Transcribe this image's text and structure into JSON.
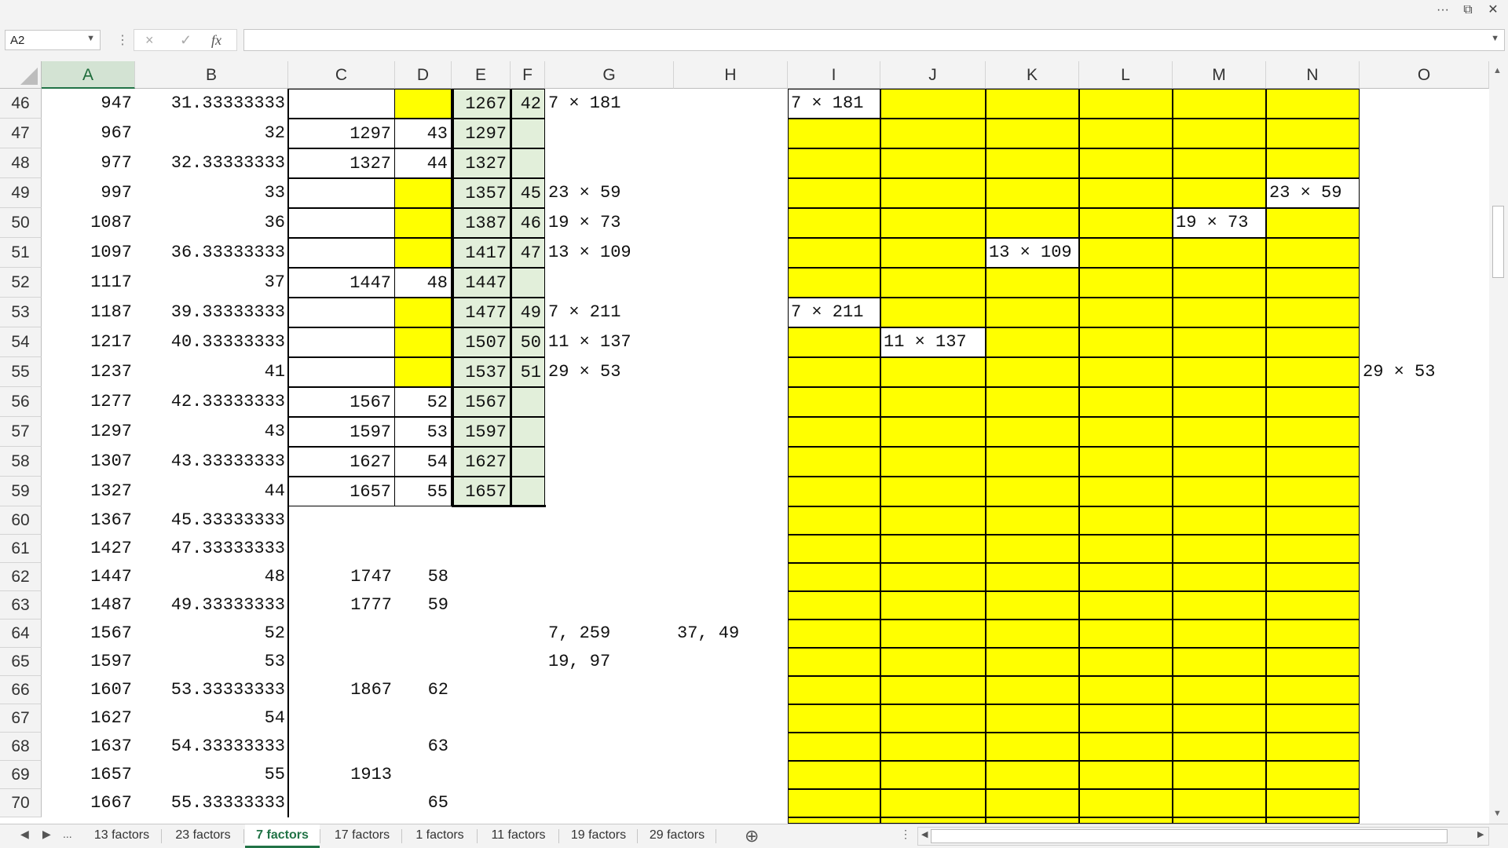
{
  "window": {
    "more_icon": "ellipsis-icon",
    "restore_icon": "restore-icon",
    "close_icon": "close-icon"
  },
  "formula_bar": {
    "name_box": "A2",
    "cancel_icon": "×",
    "enter_icon": "✓",
    "fx_label": "fx",
    "formula": ""
  },
  "columns": [
    "A",
    "B",
    "C",
    "D",
    "E",
    "F",
    "G",
    "H",
    "I",
    "J",
    "K",
    "L",
    "M",
    "N",
    "O"
  ],
  "selected_column": "A",
  "rows": [
    {
      "n": "46",
      "A": "947",
      "B": "31.33333333",
      "C": "",
      "D": "",
      "E": "1267",
      "F": "42",
      "G": "7 × 181",
      "H": ""
    },
    {
      "n": "47",
      "A": "967",
      "B": "32",
      "C": "1297",
      "D": "43",
      "E": "1297",
      "F": "",
      "G": "",
      "H": ""
    },
    {
      "n": "48",
      "A": "977",
      "B": "32.33333333",
      "C": "1327",
      "D": "44",
      "E": "1327",
      "F": "",
      "G": "",
      "H": ""
    },
    {
      "n": "49",
      "A": "997",
      "B": "33",
      "C": "",
      "D": "",
      "E": "1357",
      "F": "45",
      "G": "23 × 59",
      "H": ""
    },
    {
      "n": "50",
      "A": "1087",
      "B": "36",
      "C": "",
      "D": "",
      "E": "1387",
      "F": "46",
      "G": "19 × 73",
      "H": ""
    },
    {
      "n": "51",
      "A": "1097",
      "B": "36.33333333",
      "C": "",
      "D": "",
      "E": "1417",
      "F": "47",
      "G": "13 × 109",
      "H": ""
    },
    {
      "n": "52",
      "A": "1117",
      "B": "37",
      "C": "1447",
      "D": "48",
      "E": "1447",
      "F": "",
      "G": "",
      "H": ""
    },
    {
      "n": "53",
      "A": "1187",
      "B": "39.33333333",
      "C": "",
      "D": "",
      "E": "1477",
      "F": "49",
      "G": "7 × 211",
      "H": ""
    },
    {
      "n": "54",
      "A": "1217",
      "B": "40.33333333",
      "C": "",
      "D": "",
      "E": "1507",
      "F": "50",
      "G": "11 × 137",
      "H": ""
    },
    {
      "n": "55",
      "A": "1237",
      "B": "41",
      "C": "",
      "D": "",
      "E": "1537",
      "F": "51",
      "G": "29 × 53",
      "H": ""
    },
    {
      "n": "56",
      "A": "1277",
      "B": "42.33333333",
      "C": "1567",
      "D": "52",
      "E": "1567",
      "F": "",
      "G": "",
      "H": ""
    },
    {
      "n": "57",
      "A": "1297",
      "B": "43",
      "C": "1597",
      "D": "53",
      "E": "1597",
      "F": "",
      "G": "",
      "H": ""
    },
    {
      "n": "58",
      "A": "1307",
      "B": "43.33333333",
      "C": "1627",
      "D": "54",
      "E": "1627",
      "F": "",
      "G": "",
      "H": ""
    },
    {
      "n": "59",
      "A": "1327",
      "B": "44",
      "C": "1657",
      "D": "55",
      "E": "1657",
      "F": "",
      "G": "",
      "H": ""
    },
    {
      "n": "60",
      "A": "1367",
      "B": "45.33333333",
      "C": "",
      "D": "",
      "E": "",
      "F": "",
      "G": "",
      "H": ""
    },
    {
      "n": "61",
      "A": "1427",
      "B": "47.33333333",
      "C": "",
      "D": "",
      "E": "",
      "F": "",
      "G": "",
      "H": ""
    },
    {
      "n": "62",
      "A": "1447",
      "B": "48",
      "C": "1747",
      "D": "58",
      "E": "",
      "F": "",
      "G": "",
      "H": ""
    },
    {
      "n": "63",
      "A": "1487",
      "B": "49.33333333",
      "C": "1777",
      "D": "59",
      "E": "",
      "F": "",
      "G": "",
      "H": ""
    },
    {
      "n": "64",
      "A": "1567",
      "B": "52",
      "C": "",
      "D": "",
      "E": "",
      "F": "",
      "G": "7, 259",
      "H": "37, 49"
    },
    {
      "n": "65",
      "A": "1597",
      "B": "53",
      "C": "",
      "D": "",
      "E": "",
      "F": "",
      "G": "19, 97",
      "H": ""
    },
    {
      "n": "66",
      "A": "1607",
      "B": "53.33333333",
      "C": "1867",
      "D": "62",
      "E": "",
      "F": "",
      "G": "",
      "H": ""
    },
    {
      "n": "67",
      "A": "1627",
      "B": "54",
      "C": "",
      "D": "",
      "E": "",
      "F": "",
      "G": "",
      "H": ""
    },
    {
      "n": "68",
      "A": "1637",
      "B": "54.33333333",
      "C": "",
      "D": "63",
      "E": "",
      "F": "",
      "G": "",
      "H": ""
    },
    {
      "n": "69",
      "A": "1657",
      "B": "55",
      "C": "1913",
      "D": "",
      "E": "",
      "F": "",
      "G": "",
      "H": ""
    },
    {
      "n": "70",
      "A": "1667",
      "B": "55.33333333",
      "C": "",
      "D": "65",
      "E": "",
      "F": "",
      "G": "",
      "H": ""
    }
  ],
  "yellow_d_rows": [
    "46",
    "49",
    "50",
    "51",
    "53",
    "54",
    "55"
  ],
  "grid_labels": [
    {
      "row": "46",
      "col": "I",
      "text": "7 × 181"
    },
    {
      "row": "49",
      "col": "N",
      "text": "23 × 59"
    },
    {
      "row": "50",
      "col": "M",
      "text": "19 × 73"
    },
    {
      "row": "51",
      "col": "K",
      "text": "13 × 109"
    },
    {
      "row": "53",
      "col": "I",
      "text": "7 × 211"
    },
    {
      "row": "54",
      "col": "J",
      "text": "11 × 137"
    },
    {
      "row": "55",
      "col": "O",
      "text": "29 × 53"
    }
  ],
  "colors": {
    "highlight": "#ffff00",
    "green_cell": "#e2efda",
    "accent": "#217346"
  },
  "sheet_tabs": [
    "13 factors",
    "23 factors",
    "7 factors",
    "17 factors",
    "1 factors",
    "11 factors",
    "19 factors",
    "29 factors"
  ],
  "active_tab": "7 factors",
  "tab_nav": {
    "prev": "◀",
    "next": "▶",
    "more": "..."
  },
  "add_sheet_icon": "⊕"
}
